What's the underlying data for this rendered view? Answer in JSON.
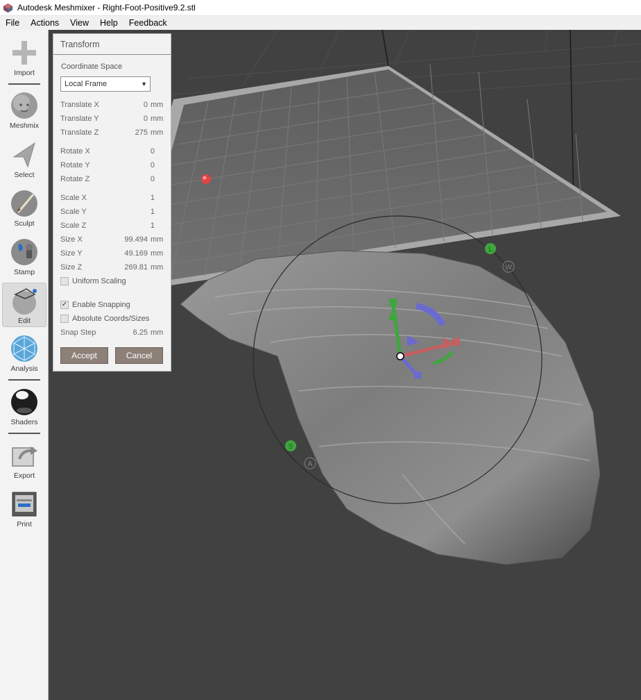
{
  "window": {
    "title": "Autodesk Meshmixer - Right-Foot-Positive9.2.stl"
  },
  "menu": [
    "File",
    "Actions",
    "View",
    "Help",
    "Feedback"
  ],
  "toolbar": [
    {
      "label": "Import",
      "icon": "plus-icon"
    },
    {
      "label": "Meshmix",
      "icon": "meshmix-head-icon"
    },
    {
      "label": "Select",
      "icon": "select-arrow-icon"
    },
    {
      "label": "Sculpt",
      "icon": "sculpt-brush-icon"
    },
    {
      "label": "Stamp",
      "icon": "stamp-icon"
    },
    {
      "label": "Edit",
      "icon": "edit-sphere-icon",
      "active": true
    },
    {
      "label": "Analysis",
      "icon": "analysis-mesh-icon"
    },
    {
      "label": "Shaders",
      "icon": "shaders-sphere-icon"
    },
    {
      "label": "Export",
      "icon": "export-icon"
    },
    {
      "label": "Print",
      "icon": "printer-icon"
    }
  ],
  "transform_panel": {
    "title": "Transform",
    "coordinate_space_label": "Coordinate Space",
    "coordinate_space_value": "Local Frame",
    "translate": [
      {
        "label": "Translate X",
        "value": "0",
        "unit": "mm"
      },
      {
        "label": "Translate Y",
        "value": "0",
        "unit": "mm"
      },
      {
        "label": "Translate Z",
        "value": "275",
        "unit": "mm"
      }
    ],
    "rotate": [
      {
        "label": "Rotate X",
        "value": "0"
      },
      {
        "label": "Rotate Y",
        "value": "0"
      },
      {
        "label": "Rotate Z",
        "value": "0"
      }
    ],
    "scale": [
      {
        "label": "Scale X",
        "value": "1"
      },
      {
        "label": "Scale Y",
        "value": "1"
      },
      {
        "label": "Scale Z",
        "value": "1"
      }
    ],
    "size": [
      {
        "label": "Size X",
        "value": "99.494",
        "unit": "mm"
      },
      {
        "label": "Size Y",
        "value": "49.169",
        "unit": "mm"
      },
      {
        "label": "Size Z",
        "value": "269.81",
        "unit": "mm"
      }
    ],
    "uniform_scaling": {
      "label": "Uniform Scaling",
      "checked": false
    },
    "enable_snapping": {
      "label": "Enable Snapping",
      "checked": true
    },
    "absolute_coords": {
      "label": "Absolute Coords/Sizes",
      "checked": false
    },
    "snap_step": {
      "label": "Snap Step",
      "value": "6.25",
      "unit": "mm"
    },
    "accept_label": "Accept",
    "cancel_label": "Cancel"
  },
  "gizmo_handles": {
    "l": "L",
    "w": "W",
    "s": "S",
    "a": "A"
  },
  "colors": {
    "viewport_bg": "#414141",
    "accent_button": "#8d8078",
    "gizmo_green": "#3fa63f",
    "gizmo_red": "#c44",
    "gizmo_blue": "#6a6ad0"
  }
}
